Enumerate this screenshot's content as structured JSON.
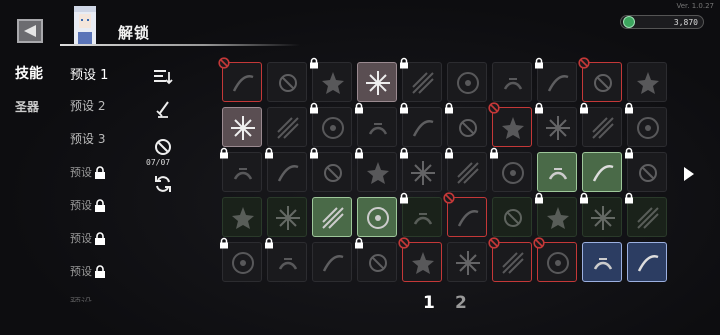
{
  "version": "Ver. 1.0.27",
  "header": {
    "title": "解锁",
    "currency_value": "3,870"
  },
  "tabs": [
    {
      "label": "技能"
    },
    {
      "label": "圣器"
    }
  ],
  "presets": [
    {
      "label": "预设 1",
      "locked": false
    },
    {
      "label": "预设 2",
      "locked": false
    },
    {
      "label": "预设 3",
      "locked": false
    },
    {
      "label": "预设",
      "locked": true
    },
    {
      "label": "预设",
      "locked": true
    },
    {
      "label": "预设",
      "locked": true
    },
    {
      "label": "预设",
      "locked": true
    },
    {
      "label": "预设",
      "locked": true
    }
  ],
  "controls": {
    "ban_count": "07/07"
  },
  "pagination": {
    "pages": [
      "1",
      "2"
    ],
    "current": "1"
  },
  "colors": {
    "accent_green": "#3ca55e",
    "ban_red": "#c43838",
    "highlight_green": "#9ec79a",
    "highlight_blue": "#9cb0e0"
  },
  "grid": {
    "rows": [
      [
        {
          "s": "ban-red"
        },
        {
          "s": "dim"
        },
        {
          "s": "lock"
        },
        {
          "s": "white"
        },
        {
          "s": "lock"
        },
        {
          "s": "dim"
        },
        {
          "s": "dim"
        },
        {
          "s": "lock"
        },
        {
          "s": "ban-red"
        },
        {
          "s": "dim"
        }
      ],
      [
        {
          "s": "white"
        },
        {
          "s": "dim"
        },
        {
          "s": "lock"
        },
        {
          "s": "lock"
        },
        {
          "s": "lock"
        },
        {
          "s": "lock"
        },
        {
          "s": "ban-red"
        },
        {
          "s": "lock"
        },
        {
          "s": "lock"
        },
        {
          "s": "lock"
        }
      ],
      [
        {
          "s": "lock"
        },
        {
          "s": "lock"
        },
        {
          "s": "lock"
        },
        {
          "s": "lock"
        },
        {
          "s": "lock"
        },
        {
          "s": "lock"
        },
        {
          "s": "lock"
        },
        {
          "s": "green"
        },
        {
          "s": "green"
        },
        {
          "s": "lock"
        }
      ],
      [
        {
          "s": "dark"
        },
        {
          "s": "dark"
        },
        {
          "s": "green"
        },
        {
          "s": "green"
        },
        {
          "s": "lock-dark"
        },
        {
          "s": "ban-red"
        },
        {
          "s": "dark"
        },
        {
          "s": "lock-dark"
        },
        {
          "s": "lock-dark"
        },
        {
          "s": "lock-dark"
        }
      ],
      [
        {
          "s": "lock"
        },
        {
          "s": "lock"
        },
        {
          "s": "dim"
        },
        {
          "s": "lock"
        },
        {
          "s": "ban-red"
        },
        {
          "s": "dim"
        },
        {
          "s": "ban-red"
        },
        {
          "s": "ban-red"
        },
        {
          "s": "blue"
        },
        {
          "s": "blue"
        }
      ]
    ]
  }
}
